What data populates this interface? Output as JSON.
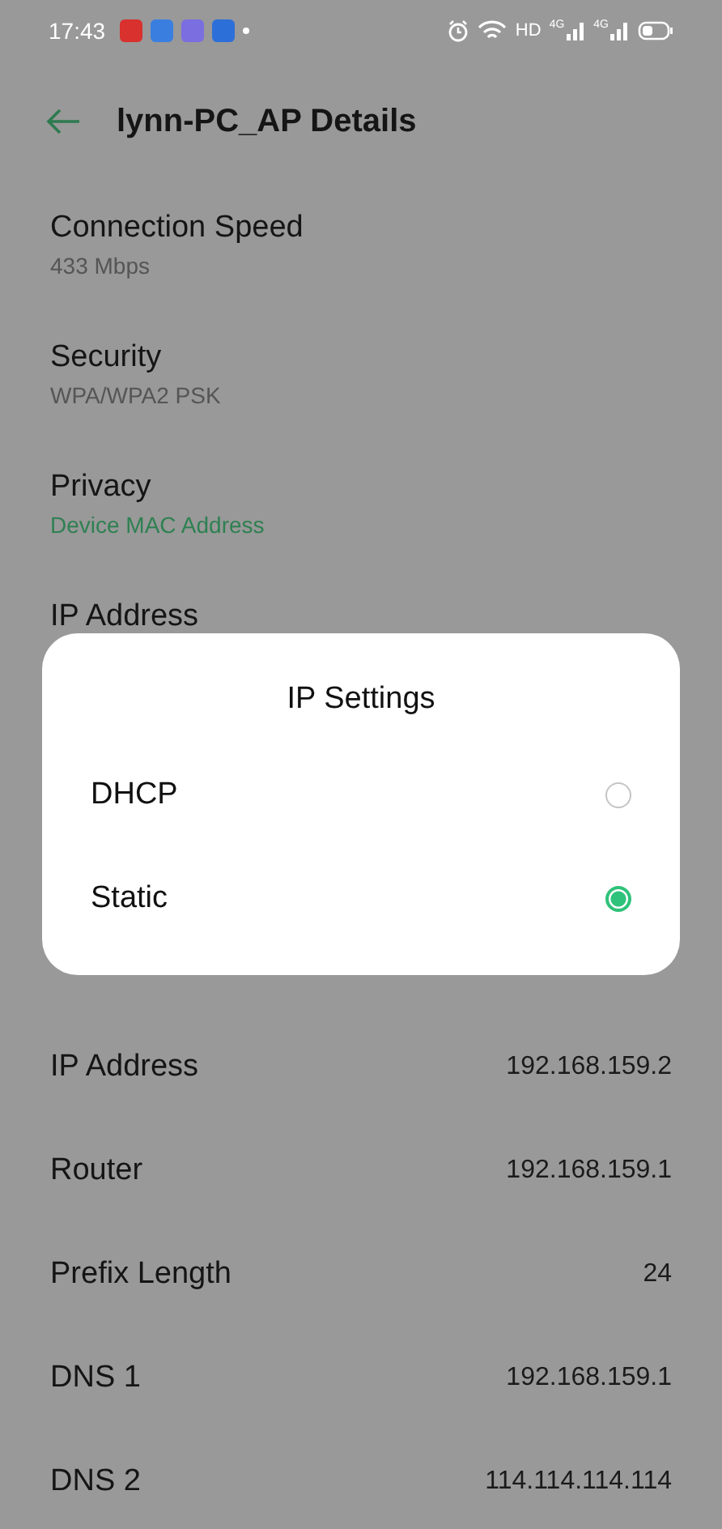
{
  "status_bar": {
    "time": "17:43",
    "hd": "HD",
    "networks": [
      "4G",
      "4G"
    ]
  },
  "header": {
    "title": "lynn-PC_AP Details"
  },
  "details": [
    {
      "title": "Connection Speed",
      "value": "433 Mbps",
      "accent": false
    },
    {
      "title": "Security",
      "value": "WPA/WPA2 PSK",
      "accent": false
    },
    {
      "title": "Privacy",
      "value": "Device MAC Address",
      "accent": true
    },
    {
      "title": "IP Address"
    }
  ],
  "static_rows": [
    {
      "label": "IP Address",
      "value": "192.168.159.2"
    },
    {
      "label": "Router",
      "value": "192.168.159.1"
    },
    {
      "label": "Prefix Length",
      "value": "24"
    },
    {
      "label": "DNS 1",
      "value": "192.168.159.1"
    },
    {
      "label": "DNS 2",
      "value": "114.114.114.114"
    }
  ],
  "dialog": {
    "title": "IP Settings",
    "options": [
      {
        "label": "DHCP",
        "selected": false
      },
      {
        "label": "Static",
        "selected": true
      }
    ]
  }
}
